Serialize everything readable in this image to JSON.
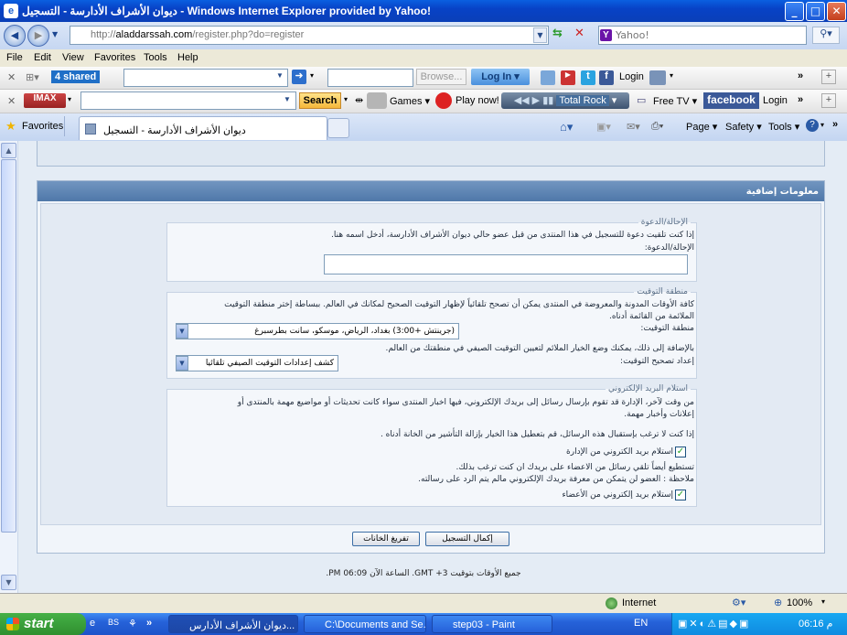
{
  "window": {
    "title": "ديوان الأشراف الأدارسة - التسجيل - Windows Internet Explorer provided by Yahoo!"
  },
  "browser": {
    "url_prefix": "http://",
    "url_domain": "aladdarssah.com",
    "url_path": "/register.php?do=register",
    "search_placeholder": "Yahoo!",
    "menu": [
      "File",
      "Edit",
      "View",
      "Favorites",
      "Tools",
      "Help"
    ],
    "toolbar1": {
      "shared_label": "4 shared",
      "browse": "Browse...",
      "login_btn": "Log In",
      "login_text": "Login"
    },
    "toolbar2": {
      "search_btn": "Search",
      "games": "Games",
      "play_now": "Play now!",
      "radio": "Total Rock",
      "free_tv": "Free TV",
      "facebook": "facebook",
      "login": "Login"
    },
    "favorites": "Favorites",
    "tab_title": "ديوان الأشراف الأدارسة - التسجيل",
    "cmd": {
      "page": "Page",
      "safety": "Safety",
      "tools": "Tools"
    }
  },
  "form": {
    "section_title": "معلومات إضافية",
    "referrer": {
      "legend": "الإحالة/الدعوة",
      "desc": "إذا كنت تلقيت دعوة للتسجيل في هذا المنتدى من قبل عضو حالي ديوان الأشراف الأدارسة، أدخل اسمه هنا.",
      "label": "الإحالة/الدعوة:",
      "value": ""
    },
    "timezone": {
      "legend": "منطقة التوقيت",
      "desc1": "كافة الأوقات المدونة والمعروضة في المنتدى يمكن أن تصحح تلقائياً لإظهار التوقيت الصحيح لمكانك في العالم. ببساطة إختر منطقة التوقيت",
      "desc2": "الملائمة من القائمة أدناه.",
      "label": "منطقة التوقيت:",
      "selected": "(جرينتش +3:00) بغداد، الرياض، موسكو، سانت بطرسبرغ",
      "dst_desc": "بالإضافة إلى ذلك، يمكنك وضع الخيار الملائم لتعيين التوقيت الصيفي في منطقتك من العالم.",
      "dst_label": "إعداد تصحيح التوقيت:",
      "dst_selected": "كشف إعدادات التوقيت الصيفي تلقائيا"
    },
    "email": {
      "legend": "استلام البريد الإلكتروني",
      "desc1": "من وقت لآخر، الإدارة قد تقوم بإرسال رسائل إلى بريدك الإلكتروني، فيها اخبار المنتدى سواء كانت تحديثات أو مواضيع مهمة بالمنتدى أو",
      "desc2": "إعلانات وأخبار مهمة.",
      "desc3": "إذا كنت لا ترغب بإستقبال هذه الرسائل، قم بتعطيل هذا الخيار بإزالة التأشير من الخانة أدناه .",
      "admin_opt": "استلام بريد الكتروني من الإدارة",
      "member_desc1": "تستطيع أيضاً تلقي رسائل من الاعضاء على بريدك ان كنت ترغب بذلك.",
      "member_desc2": "ملاحظة : العضو لن يتمكن من معرفة بريدك الإلكتروني مالم يتم الرد على رسالته.",
      "member_opt": "إستلام بريد إلكتروني من الأعضاء",
      "admin_checked": true,
      "member_checked": true
    },
    "submit": "إكمال التسجيل",
    "reset": "تفريغ الخانات",
    "footer": "جميع الأوقات بتوقيت GMT +3. الساعة الآن 06:09 PM."
  },
  "statusbar": {
    "zone": "Internet",
    "zoom": "100%"
  },
  "taskbar": {
    "start": "start",
    "tasks": [
      "ديوان الأشراف الأدارس...",
      "C:\\Documents and Se...",
      "step03 - Paint"
    ],
    "lang": "EN",
    "clock": "06:16 م"
  }
}
